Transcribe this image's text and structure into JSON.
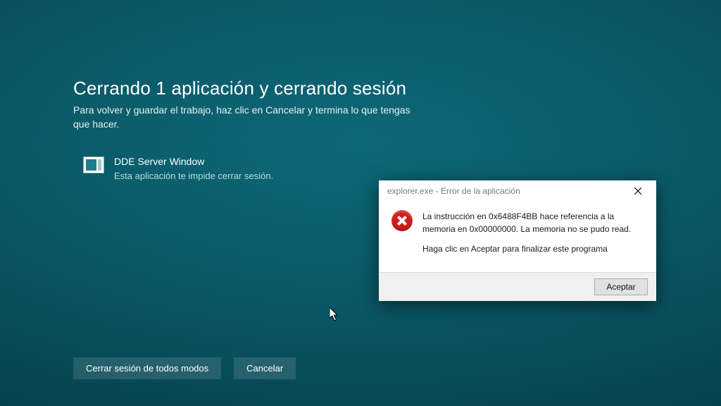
{
  "shutdown": {
    "title": "Cerrando 1 aplicación y cerrando sesión",
    "subtitle": "Para volver y guardar el trabajo, haz clic en Cancelar y termina lo que tengas que hacer.",
    "blocking_app": {
      "name": "DDE Server Window",
      "status": "Esta aplicación te impide cerrar sesión."
    },
    "actions": {
      "force": "Cerrar sesión de todos modos",
      "cancel": "Cancelar"
    }
  },
  "error_dialog": {
    "title": "explorer.exe - Error de la aplicación",
    "message_line1": "La instrucción en 0x6488F4BB hace referencia a la memoria en 0x00000000. La memoria no se pudo read.",
    "message_line2": "Haga clic en Aceptar para finalizar este programa",
    "ok": "Aceptar"
  }
}
